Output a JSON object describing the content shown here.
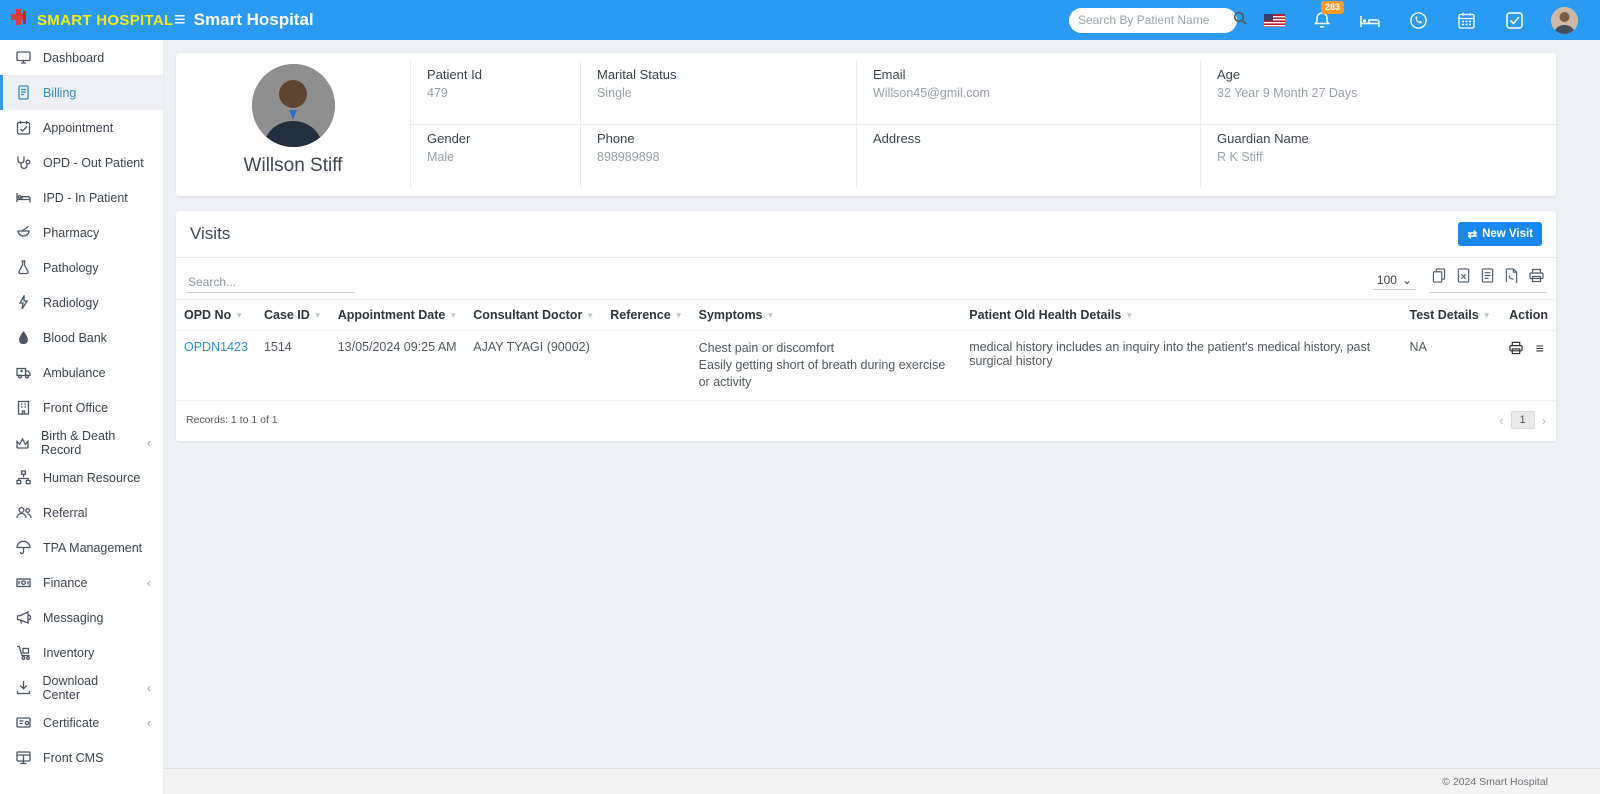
{
  "header": {
    "logo_text": "SMART HOSPITAL",
    "title": "Smart Hospital",
    "search_placeholder": "Search By Patient Name",
    "notification_count": "283"
  },
  "icons": {
    "hamburger": "≡",
    "swap": "⇄",
    "caret_down": "⌄",
    "sort": "▼",
    "chevron": "‹",
    "prev": "‹",
    "next": "›",
    "list": "≡"
  },
  "colors": {
    "header_blue": "#2b9af3",
    "logo_yellow": "#f7e912",
    "logo_red": "#e53935",
    "badge_orange": "#f89b2a",
    "active_item_blue": "#2e8fc5",
    "link_blue": "#2d8fd8",
    "button_blue": "#1788f0",
    "body_bg": "#edf0f4"
  },
  "sidebar": {
    "items": [
      {
        "label": "Dashboard"
      },
      {
        "label": "Billing",
        "active": true
      },
      {
        "label": "Appointment"
      },
      {
        "label": "OPD - Out Patient"
      },
      {
        "label": "IPD - In Patient"
      },
      {
        "label": "Pharmacy"
      },
      {
        "label": "Pathology"
      },
      {
        "label": "Radiology"
      },
      {
        "label": "Blood Bank"
      },
      {
        "label": "Ambulance"
      },
      {
        "label": "Front Office"
      },
      {
        "label": "Birth & Death Record",
        "chevron": true
      },
      {
        "label": "Human Resource"
      },
      {
        "label": "Referral"
      },
      {
        "label": "TPA Management"
      },
      {
        "label": "Finance",
        "chevron": true
      },
      {
        "label": "Messaging"
      },
      {
        "label": "Inventory"
      },
      {
        "label": "Download Center",
        "chevron": true
      },
      {
        "label": "Certificate",
        "chevron": true
      },
      {
        "label": "Front CMS"
      }
    ]
  },
  "patient": {
    "name": "Willson Stiff",
    "fields": [
      {
        "label": "Patient Id",
        "value": "479"
      },
      {
        "label": "Gender",
        "value": "Male"
      },
      {
        "label": "Marital Status",
        "value": "Single"
      },
      {
        "label": "Phone",
        "value": "898989898"
      },
      {
        "label": "Email",
        "value": "Willson45@gmil.com"
      },
      {
        "label": "Address",
        "value": ""
      },
      {
        "label": "Age",
        "value": "32 Year 9 Month 27 Days"
      },
      {
        "label": "Guardian Name",
        "value": "R K Stiff"
      }
    ]
  },
  "visits": {
    "title": "Visits",
    "new_visit_label": "New Visit",
    "search_placeholder": "Search...",
    "page_size": "100",
    "columns": [
      "OPD No",
      "Case ID",
      "Appointment Date",
      "Consultant Doctor",
      "Reference",
      "Symptoms",
      "Patient Old Health Details",
      "Test Details",
      "Action"
    ],
    "rows": [
      {
        "opd_no": "OPDN1423",
        "case_id": "1514",
        "appointment_date": "13/05/2024 09:25 AM",
        "consultant_doctor": "AJAY TYAGI (90002)",
        "reference": "",
        "symptoms": [
          "Chest pain or discomfort",
          "Easily getting short of breath during exercise or activity"
        ],
        "old_health_details": "medical history includes an inquiry into the patient's medical history, past surgical history",
        "test_details": "NA"
      }
    ],
    "records_text": "Records: 1 to 1 of 1",
    "pagination": {
      "current": "1"
    }
  },
  "footer": {
    "copyright": "© 2024 Smart Hospital"
  }
}
